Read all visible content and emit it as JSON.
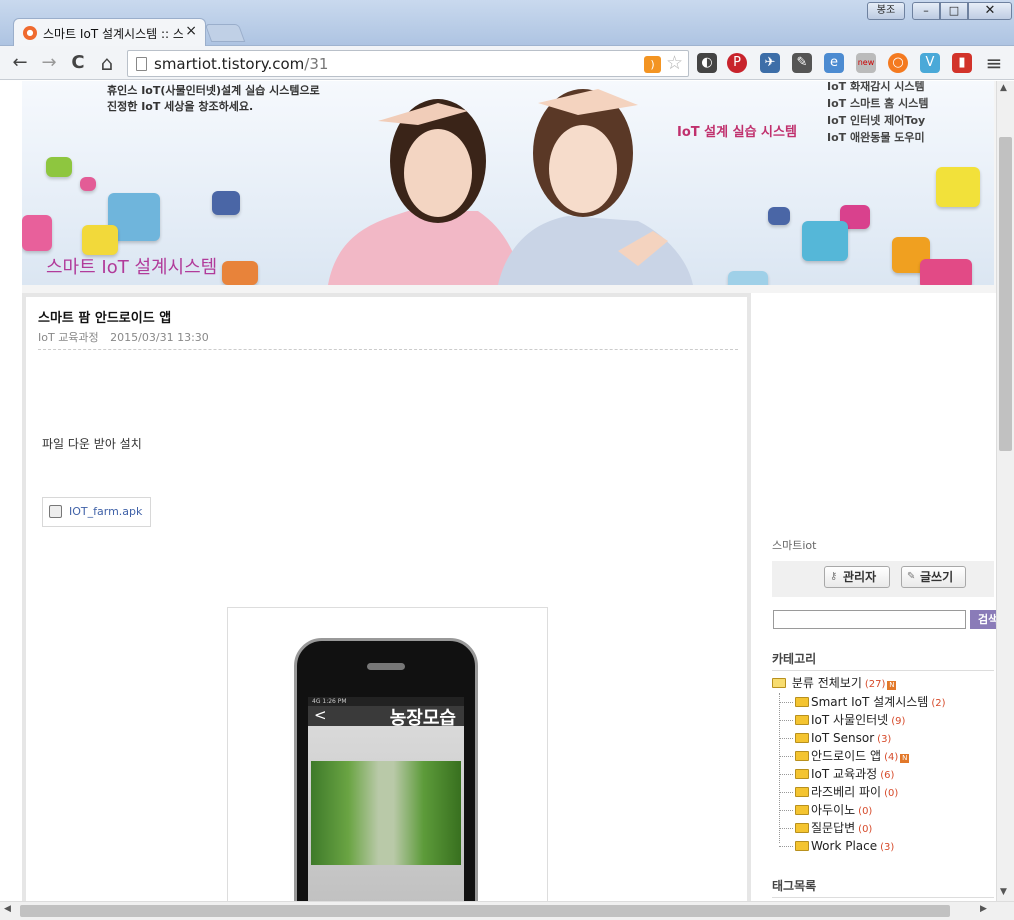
{
  "window": {
    "tab_title": "스마트 IoT 설계시스템 :: 스마트 팜 안드로이드 앱",
    "lang_button": "봉조",
    "minimize": "–",
    "maximize": "□",
    "close": "✕",
    "tab_close": "×"
  },
  "toolbar": {
    "back": "←",
    "forward": "→",
    "reload": "C",
    "home": "⌂",
    "url_host": "smartiot.tistory.com",
    "url_path": "/31",
    "rss": ")",
    "star": "☆",
    "menu": "≡"
  },
  "banner": {
    "intro_line1": "휴인스 IoT(사물인터넷)설계 실습 시스템으로",
    "intro_line2": "진정한 IoT 세상을 창조하세요.",
    "tagline": "IoT 설계 실습 시스템",
    "menu": [
      "IoT 화재감시 시스템",
      "IoT 스마트 홈 시스템",
      "IoT 인터넷 제어Toy",
      "IoT 애완동물 도우미"
    ],
    "logo": "스마트 IoT 설계시스템"
  },
  "post": {
    "title": "스마트 팜 안드로이드 앱",
    "category": "IoT 교육과정",
    "date": "2015/03/31 13:30",
    "text": "파일 다운 받아 설치",
    "attachment": "IOT_farm.apk",
    "phone_back": "<",
    "phone_title": "농장모습",
    "phone_status": "4G        1:26 PM"
  },
  "sidebar": {
    "blog_name": "스마트iot",
    "admin_button": "관리자",
    "write_button": "글쓰기",
    "search_button": "검색",
    "category_heading": "카테고리",
    "category_root": "분류 전체보기",
    "category_root_count": "(27)",
    "categories": [
      {
        "label": "Smart IoT 설계시스템",
        "count": "(2)",
        "new": false
      },
      {
        "label": "IoT 사물인터넷",
        "count": "(9)",
        "new": false
      },
      {
        "label": "IoT Sensor",
        "count": "(3)",
        "new": false
      },
      {
        "label": "안드로이드 앱",
        "count": "(4)",
        "new": true
      },
      {
        "label": "IoT 교육과정",
        "count": "(6)",
        "new": false
      },
      {
        "label": "라즈베리 파이",
        "count": "(0)",
        "new": false
      },
      {
        "label": "아두이노",
        "count": "(0)",
        "new": false
      },
      {
        "label": "질문답변",
        "count": "(0)",
        "new": false
      },
      {
        "label": "Work Place",
        "count": "(3)",
        "new": false
      }
    ],
    "tag_heading": "태그목록",
    "new_badge": "N"
  },
  "colors": {
    "accent_pink": "#c0306d",
    "logo_purple": "#b13b9a",
    "count_red": "#d64a2a",
    "search_purple": "#8a7bb8"
  }
}
